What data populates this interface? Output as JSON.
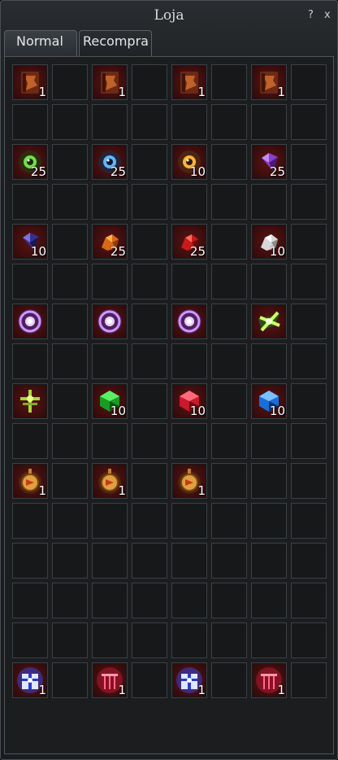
{
  "window": {
    "title": "Loja",
    "help_label": "?",
    "close_label": "x"
  },
  "tabs": [
    {
      "label": "Normal",
      "active": true
    },
    {
      "label": "Recompra",
      "active": false
    }
  ],
  "grid": {
    "columns": 8,
    "rows": 16
  },
  "colors": {
    "item_slot_bg": "#5a1414",
    "frame": "#4a4f55"
  },
  "items": [
    {
      "row": 0,
      "col": 0,
      "icon": "scroll-book-icon",
      "qty": "1"
    },
    {
      "row": 0,
      "col": 2,
      "icon": "scroll-book-icon",
      "qty": "1"
    },
    {
      "row": 0,
      "col": 4,
      "icon": "scroll-book-icon",
      "qty": "1"
    },
    {
      "row": 0,
      "col": 6,
      "icon": "scroll-book-icon",
      "qty": "1"
    },
    {
      "row": 2,
      "col": 0,
      "icon": "green-orb-icon",
      "qty": "25"
    },
    {
      "row": 2,
      "col": 2,
      "icon": "blue-orb-icon",
      "qty": "25"
    },
    {
      "row": 2,
      "col": 4,
      "icon": "orange-orb-icon",
      "qty": "10"
    },
    {
      "row": 2,
      "col": 6,
      "icon": "purple-crystal-icon",
      "qty": "25"
    },
    {
      "row": 4,
      "col": 0,
      "icon": "dark-crystal-icon",
      "qty": "10"
    },
    {
      "row": 4,
      "col": 2,
      "icon": "orange-ore-icon",
      "qty": "25"
    },
    {
      "row": 4,
      "col": 4,
      "icon": "red-ore-icon",
      "qty": "25"
    },
    {
      "row": 4,
      "col": 6,
      "icon": "white-ore-icon",
      "qty": "10"
    },
    {
      "row": 6,
      "col": 0,
      "icon": "violet-sphere-icon",
      "qty": ""
    },
    {
      "row": 6,
      "col": 2,
      "icon": "violet-sphere-icon",
      "qty": ""
    },
    {
      "row": 6,
      "col": 4,
      "icon": "violet-sphere-icon",
      "qty": ""
    },
    {
      "row": 6,
      "col": 6,
      "icon": "green-star-icon",
      "qty": ""
    },
    {
      "row": 8,
      "col": 0,
      "icon": "green-cross-relic-icon",
      "qty": ""
    },
    {
      "row": 8,
      "col": 2,
      "icon": "green-gem-icon",
      "qty": "10"
    },
    {
      "row": 8,
      "col": 4,
      "icon": "red-gem-icon",
      "qty": "10"
    },
    {
      "row": 8,
      "col": 6,
      "icon": "blue-gem-icon",
      "qty": "10"
    },
    {
      "row": 10,
      "col": 0,
      "icon": "amber-amulet-icon",
      "qty": "1"
    },
    {
      "row": 10,
      "col": 2,
      "icon": "amber-amulet-icon",
      "qty": "1"
    },
    {
      "row": 10,
      "col": 4,
      "icon": "amber-amulet-icon",
      "qty": "1"
    },
    {
      "row": 15,
      "col": 0,
      "icon": "blue-gift-box-icon",
      "qty": "1"
    },
    {
      "row": 15,
      "col": 2,
      "icon": "red-gift-box-icon",
      "qty": "1"
    },
    {
      "row": 15,
      "col": 4,
      "icon": "blue-gift-box-icon",
      "qty": "1"
    },
    {
      "row": 15,
      "col": 6,
      "icon": "red-gift-box-icon",
      "qty": "1"
    }
  ]
}
